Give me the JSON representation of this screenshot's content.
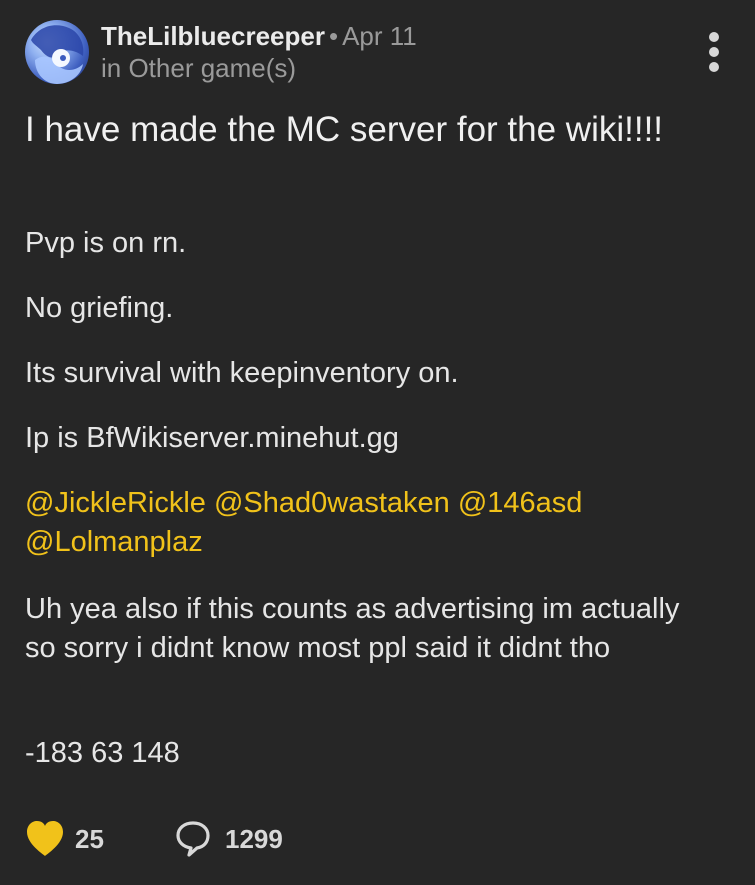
{
  "post": {
    "author": "TheLilbluecreeper",
    "separator": "•",
    "date": "Apr 11",
    "category": "in Other game(s)",
    "title": "I have made the MC server for the wiki!!!!",
    "paragraphs": [
      "Pvp is on rn.",
      "No griefing.",
      "Its survival with keepinventory on.",
      "Ip is BfWikiserver.minehut.gg"
    ],
    "mentions": [
      "@JickleRickle",
      "@Shad0wastaken",
      "@146asd",
      "@Lolmanplaz"
    ],
    "disclaimer": "Uh yea also if this counts as advertising im actually so sorry i didnt know most ppl said it didnt tho",
    "coords": "-183 63 148"
  },
  "footer": {
    "like_count": "25",
    "comment_count": "1299"
  },
  "colors": {
    "background": "#262626",
    "mention": "#f1c21a",
    "like": "#f1c21a",
    "muted": "#9a9a9a"
  },
  "icons": {
    "like": "heart-icon",
    "comment": "speech-bubble-icon",
    "menu": "more-vertical-icon"
  }
}
